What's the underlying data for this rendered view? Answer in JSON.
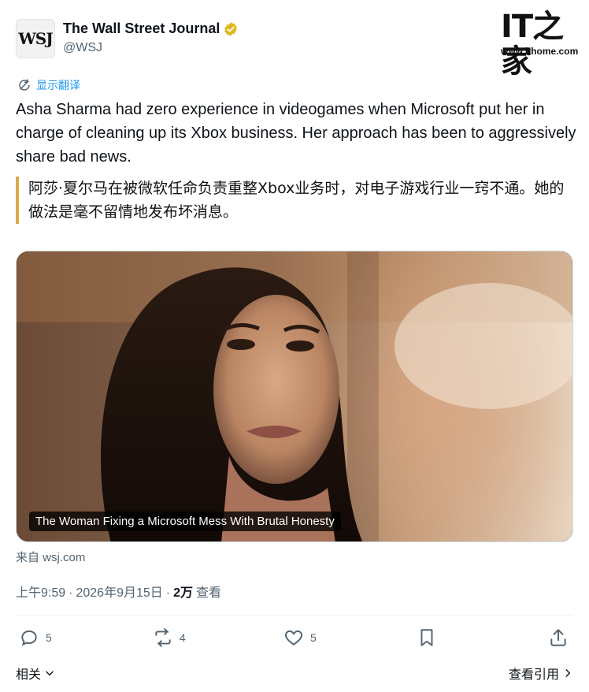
{
  "account": {
    "avatar_text": "WSJ",
    "display_name": "The Wall Street Journal",
    "handle": "@WSJ"
  },
  "logo": {
    "mark": "IT之家",
    "url": "www.ithome.com"
  },
  "post": {
    "translate_label": "显示翻译",
    "text": "Asha Sharma had zero experience in videogames when Microsoft put her in charge of cleaning up its Xbox business. Her approach has been to aggressively share bad news.",
    "quote_text": "阿莎·夏尔马在被微软任命负责重整Xbox业务时，对电子游戏行业一窍不通。她的做法是毫不留情地发布坏消息。"
  },
  "card": {
    "caption": "The Woman Fixing a Microsoft Mess With Brutal Honesty",
    "source": "来自 wsj.com"
  },
  "meta": {
    "time": "上午9:59",
    "date": "2026年9月15日",
    "views": "2万",
    "views_label": "查看",
    "sep": "·"
  },
  "actions": {
    "replies": "5",
    "reposts": "4",
    "likes": "5"
  },
  "footer": {
    "related": "相关",
    "view_quotes": "查看引用"
  },
  "colors": {
    "accent": "#1d9bf0",
    "muted": "#536471",
    "quote_bar": "#d8ab4a",
    "verified": "#e2b719"
  }
}
